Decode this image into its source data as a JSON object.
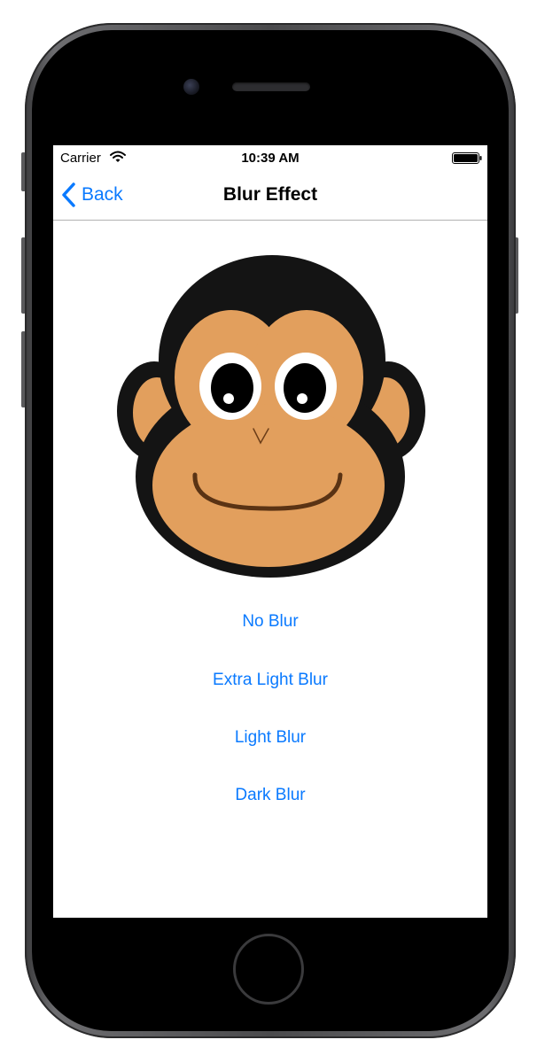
{
  "status_bar": {
    "carrier": "Carrier",
    "time": "10:39 AM"
  },
  "nav": {
    "back_label": "Back",
    "title": "Blur Effect"
  },
  "buttons": {
    "no_blur": "No Blur",
    "extra_light_blur": "Extra Light Blur",
    "light_blur": "Light Blur",
    "dark_blur": "Dark Blur"
  },
  "colors": {
    "accent": "#0a7aff",
    "monkey_fur": "#141414",
    "monkey_face": "#e29f5d",
    "monkey_mouth": "#6b3d18"
  },
  "icons": {
    "wifi": "wifi-icon",
    "battery": "battery-icon",
    "back": "chevron-left-icon"
  }
}
